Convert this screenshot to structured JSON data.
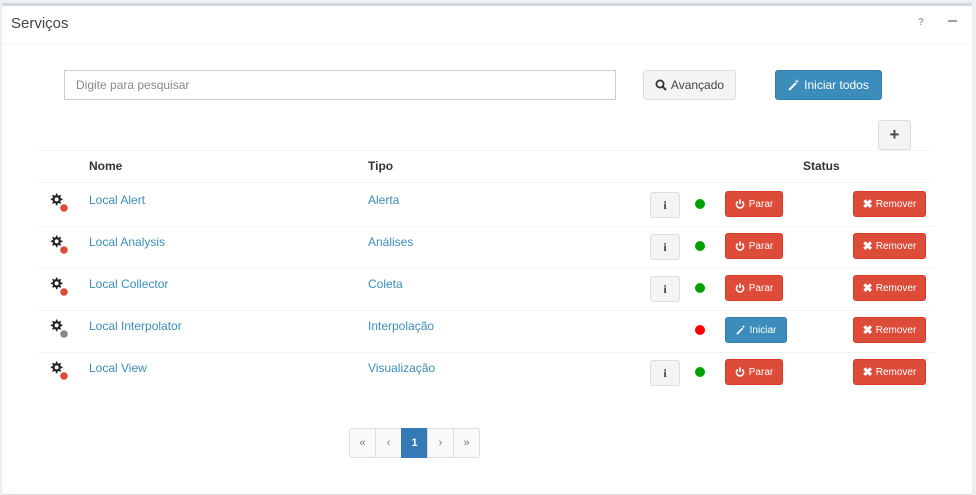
{
  "panel": {
    "title": "Serviços",
    "help_label": "?"
  },
  "toolbar": {
    "search_placeholder": "Digite para pesquisar",
    "advanced_label": "Avançado",
    "start_all_label": "Iniciar todos",
    "add_label": "+"
  },
  "table": {
    "headers": {
      "name": "Nome",
      "type": "Tipo",
      "status": "Status"
    },
    "rows": [
      {
        "name": "Local Alert",
        "type": "Alerta",
        "info": "i",
        "running": true,
        "action": "Parar",
        "remove": "Remover",
        "badge_color": "#dd4b39"
      },
      {
        "name": "Local Analysis",
        "type": "Análises",
        "info": "i",
        "running": true,
        "action": "Parar",
        "remove": "Remover",
        "badge_color": "#dd4b39"
      },
      {
        "name": "Local Collector",
        "type": "Coleta",
        "info": "i",
        "running": true,
        "action": "Parar",
        "remove": "Remover",
        "badge_color": "#dd4b39"
      },
      {
        "name": "Local Interpolator",
        "type": "Interpolação",
        "info": "",
        "running": false,
        "action": "Iniciar",
        "remove": "Remover",
        "badge_color": "#888888"
      },
      {
        "name": "Local View",
        "type": "Visualização",
        "info": "i",
        "running": true,
        "action": "Parar",
        "remove": "Remover",
        "badge_color": "#dd4b39"
      }
    ]
  },
  "status_colors": {
    "running": "#00a000",
    "stopped": "#ff0000"
  },
  "pagination": {
    "first": "«",
    "prev": "‹",
    "current": "1",
    "next": "›",
    "last": "»"
  }
}
